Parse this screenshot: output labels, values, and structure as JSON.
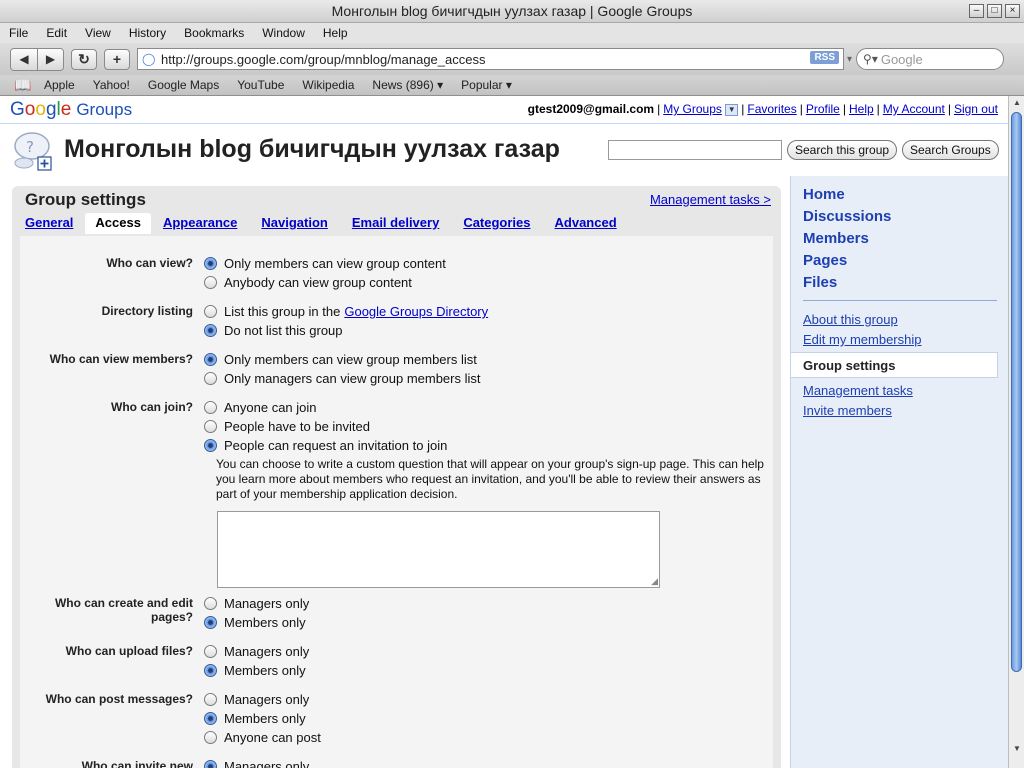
{
  "window": {
    "title": "Монголын blog бичигчдын уулзах газар | Google Groups",
    "buttons": [
      "–",
      "□",
      "×"
    ]
  },
  "menubar": [
    "File",
    "Edit",
    "View",
    "History",
    "Bookmarks",
    "Window",
    "Help"
  ],
  "toolbar": {
    "back": "◀",
    "forward": "▶",
    "reload": "↻",
    "add": "+",
    "url": "http://groups.google.com/group/mnblog/manage_access",
    "rss": "RSS",
    "search_placeholder": "Google"
  },
  "bookmarks": [
    "Apple",
    "Yahoo!",
    "Google Maps",
    "YouTube",
    "Wikipedia",
    "News (896) ▾",
    "Popular ▾"
  ],
  "header": {
    "logo_google": [
      "G",
      "o",
      "o",
      "g",
      "l",
      "e"
    ],
    "logo_groups": "Groups",
    "email": "gtest2009@gmail.com",
    "links": {
      "my_groups": "My Groups",
      "favorites": "Favorites",
      "profile": "Profile",
      "help": "Help",
      "my_account": "My Account",
      "sign_out": "Sign out"
    }
  },
  "group": {
    "title": "Монголын blog бичигчдын уулзах газар",
    "search_value": "",
    "search_group_btn": "Search this group",
    "search_groups_btn": "Search Groups"
  },
  "settings": {
    "title": "Group settings",
    "mgmt_link": "Management tasks >",
    "tabs": [
      "General",
      "Access",
      "Appearance",
      "Navigation",
      "Email delivery",
      "Categories",
      "Advanced"
    ],
    "active_tab": "Access",
    "rows": [
      {
        "label": "Who can view?",
        "options": [
          {
            "text": "Only members can view group content",
            "selected": true
          },
          {
            "text": "Anybody can view group content",
            "selected": false
          }
        ]
      },
      {
        "label": "Directory listing",
        "options": [
          {
            "text": "List this group in the",
            "link": "Google Groups Directory",
            "selected": false
          },
          {
            "text": "Do not list this group",
            "selected": true
          }
        ]
      },
      {
        "label": "Who can view members?",
        "options": [
          {
            "text": "Only members can view group members list",
            "selected": true
          },
          {
            "text": "Only managers can view group members list",
            "selected": false
          }
        ]
      },
      {
        "label": "Who can join?",
        "options": [
          {
            "text": "Anyone can join",
            "selected": false
          },
          {
            "text": "People have to be invited",
            "selected": false
          },
          {
            "text": "People can request an invitation to join",
            "selected": true
          }
        ],
        "help": "You can choose to write a custom question that will appear on your group's sign-up page. This can help you learn more about members who request an invitation, and you'll be able to review their answers as part of your membership application decision.",
        "textarea_value": ""
      },
      {
        "label": "Who can create and edit pages?",
        "options": [
          {
            "text": "Managers only",
            "selected": false
          },
          {
            "text": "Members only",
            "selected": true
          }
        ]
      },
      {
        "label": "Who can upload files?",
        "options": [
          {
            "text": "Managers only",
            "selected": false
          },
          {
            "text": "Members only",
            "selected": true
          }
        ]
      },
      {
        "label": "Who can post messages?",
        "options": [
          {
            "text": "Managers only",
            "selected": false
          },
          {
            "text": "Members only",
            "selected": true
          },
          {
            "text": "Anyone can post",
            "selected": false
          }
        ]
      },
      {
        "label": "Who can invite new",
        "options": [
          {
            "text": "Managers only",
            "selected": true
          }
        ]
      }
    ]
  },
  "rightnav": {
    "main": [
      "Home",
      "Discussions",
      "Members",
      "Pages",
      "Files"
    ],
    "about": "About this group",
    "edit_membership": "Edit my membership",
    "group_settings": "Group settings",
    "management_tasks": "Management tasks",
    "invite_members": "Invite members"
  }
}
